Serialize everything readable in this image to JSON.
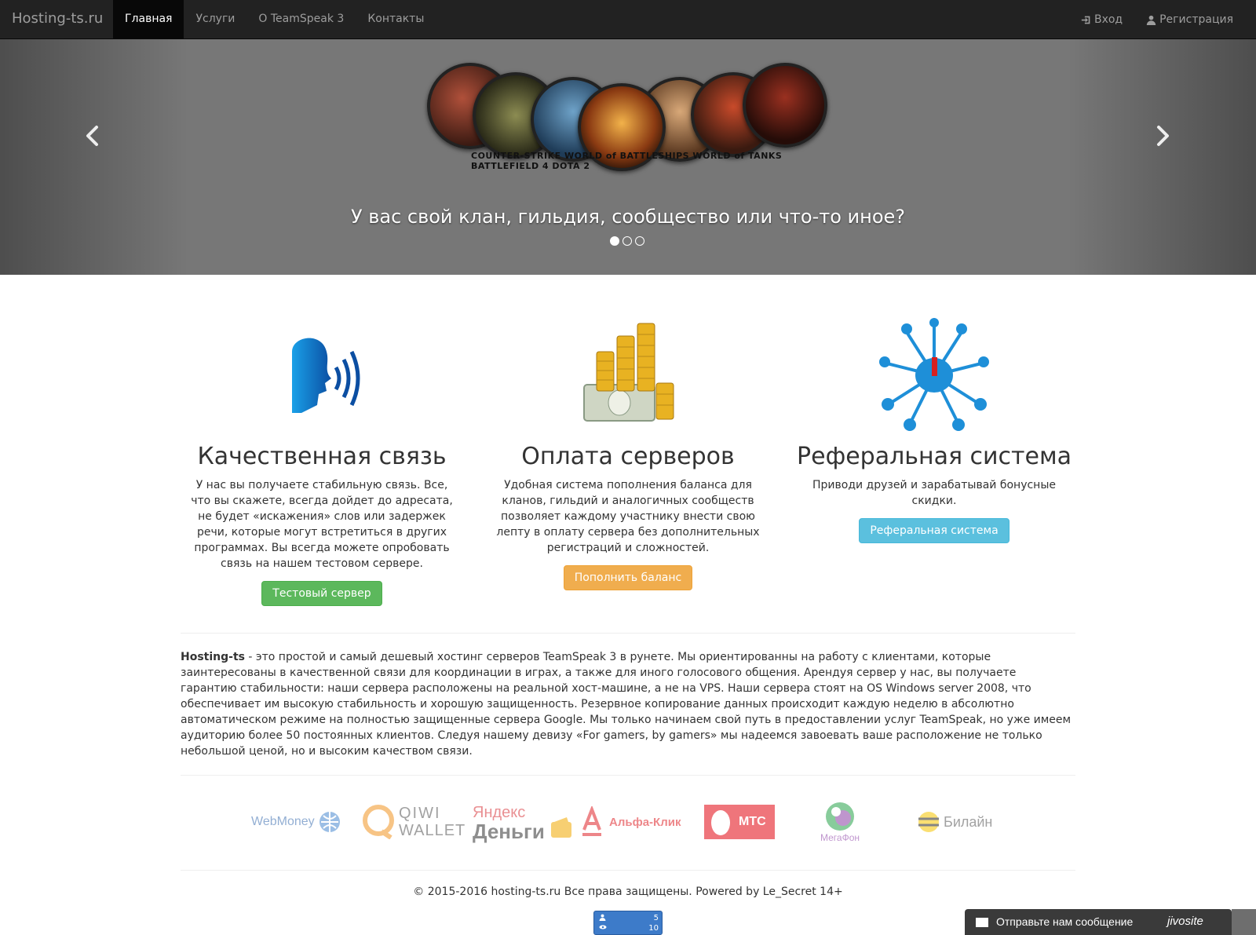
{
  "navbar": {
    "brand": "Hosting-ts.ru",
    "items": [
      {
        "label": "Главная",
        "active": true
      },
      {
        "label": "Услуги",
        "active": false
      },
      {
        "label": "О TeamSpeak 3",
        "active": false
      },
      {
        "label": "Контакты",
        "active": false
      }
    ],
    "login": "Вход",
    "register": "Регистрация"
  },
  "carousel": {
    "caption": "У вас свой клан, гильдия, сообщество или что-то иное?",
    "slide_count": 3,
    "active_slide": 1,
    "games_strip": "COUNTER-STRIKE   WORLD of BATTLESHIPS   WORLD of TANKS   BATTLEFIELD 4   DOTA 2"
  },
  "features": [
    {
      "title": "Качественная связь",
      "text": "У нас вы получаете стабильную связь. Все, что вы скажете, всегда дойдет до адресата, не будет «искажения» слов или задержек речи, которые могут встретиться в других программах. Вы всегда можете опробовать связь на нашем тестовом сервере.",
      "button": "Тестовый сервер"
    },
    {
      "title": "Оплата серверов",
      "text": "Удобная система пополнения баланса для кланов, гильдий и аналогичных сообществ позволяет каждому участнику внести свою лепту в оплату сервера без дополнительных регистраций и сложностей.",
      "button": "Пополнить баланс"
    },
    {
      "title": "Реферальная система",
      "text": "Приводи друзей и зарабатывай бонусные скидки.",
      "button": "Реферальная система"
    }
  ],
  "about": {
    "brand": "Hosting-ts",
    "text": " - это простой и самый дешевый хостинг серверов TeamSpeak 3 в рунете. Мы ориентированны на работу с клиентами, которые заинтересованы в качественной связи для координации в играх, а также для иного голосового общения. Арендуя сервер у нас, вы получаете гарантию стабильности: наши сервера расположены на реальной хост-машине, а не на VPS. Наши сервера стоят на OS Windows server 2008, что обеспечивает им высокую стабильность и хорошую защищенность. Резервное копирование данных происходит каждую неделю в абсолютно автоматическом режиме на полностью защищенные сервера Google. Мы только начинаем свой путь в предоставлении услуг TeamSpeak, но уже имеем аудиторию более 50 постоянных клиентов. Следуя нашему девизу «For gamers, by gamers» мы надеемся завоевать ваше расположение не только небольшой ценой, но и высоким качеством связи."
  },
  "payments": {
    "webmoney": "WebMoney",
    "qiwi_top": "QIWI",
    "qiwi_bottom": "WALLET",
    "yandex_top": "Яндекс",
    "yandex_bottom": "Деньги",
    "alfa": "Альфа-Клик",
    "mts": "МТС",
    "megafon": "МегаФон",
    "beeline": "Билайн"
  },
  "footer": {
    "text": "© 2015-2016 hosting-ts.ru Все права защищены. Powered by Le_Secret 14+"
  },
  "counter": {
    "visitors": "5",
    "views": "10"
  },
  "jivo": {
    "label": "Отправьте нам сообщение",
    "logo": "jivosite"
  }
}
